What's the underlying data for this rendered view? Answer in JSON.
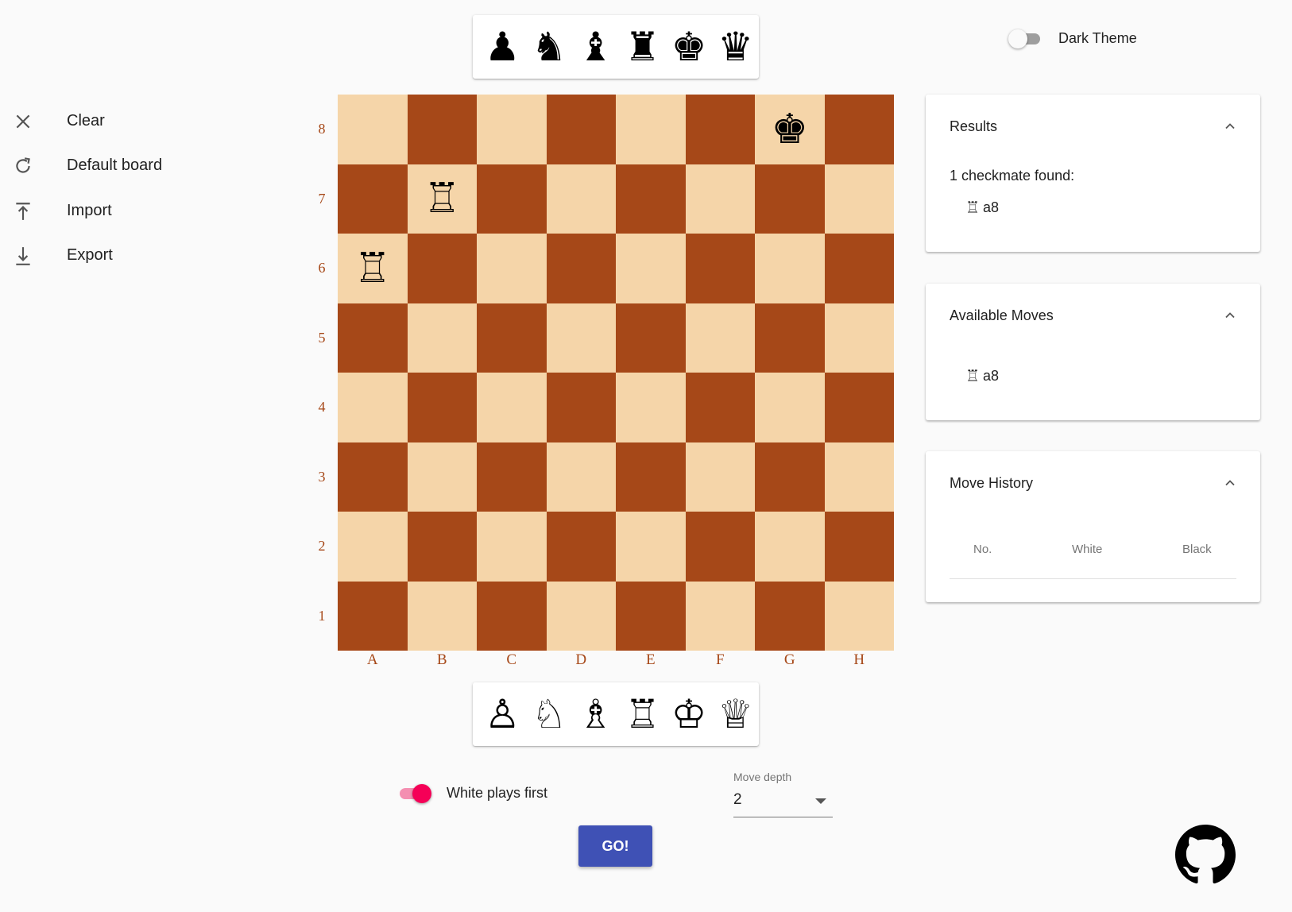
{
  "sidebar": {
    "items": [
      {
        "label": "Clear",
        "icon": "close-icon"
      },
      {
        "label": "Default board",
        "icon": "refresh-icon"
      },
      {
        "label": "Import",
        "icon": "upload-icon"
      },
      {
        "label": "Export",
        "icon": "download-icon"
      }
    ]
  },
  "theme": {
    "label": "Dark Theme",
    "enabled": false
  },
  "palettes": {
    "black": [
      "♟",
      "♞",
      "♝",
      "♜",
      "♚",
      "♛"
    ],
    "white": [
      "♙",
      "♘",
      "♗",
      "♖",
      "♔",
      "♕"
    ]
  },
  "board": {
    "files": [
      "A",
      "B",
      "C",
      "D",
      "E",
      "F",
      "G",
      "H"
    ],
    "ranks": [
      "8",
      "7",
      "6",
      "5",
      "4",
      "3",
      "2",
      "1"
    ],
    "colors": {
      "light": "#f5d5a9",
      "dark": "#a64818"
    },
    "pieces": {
      "g8": "♚",
      "b7": "♖",
      "a6": "♖"
    }
  },
  "results": {
    "title": "Results",
    "summary": "1 checkmate found:",
    "moves": [
      {
        "piece": "♖",
        "square": "a8"
      }
    ]
  },
  "available_moves": {
    "title": "Available Moves",
    "moves": [
      {
        "piece": "♖",
        "square": "a8"
      }
    ]
  },
  "move_history": {
    "title": "Move History",
    "columns": [
      "No.",
      "White",
      "Black"
    ],
    "rows": []
  },
  "controls": {
    "white_first_label": "White plays first",
    "white_first": true,
    "depth_label": "Move depth",
    "depth_value": "2",
    "go_label": "GO!"
  },
  "colors": {
    "accent": "#3f51b5",
    "toggle": "#f50057"
  }
}
